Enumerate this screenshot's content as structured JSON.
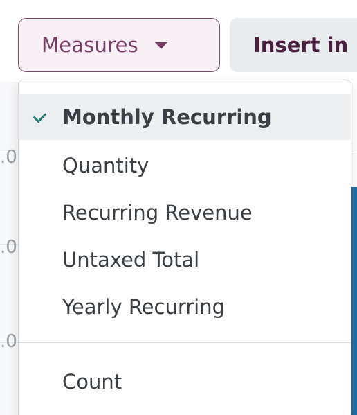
{
  "toolbar": {
    "measures_label": "Measures",
    "insert_label": "Insert in"
  },
  "chart": {
    "y_tick_fragments": [
      ".0",
      ".0",
      ".0"
    ],
    "bar_color": "#1f6fa8"
  },
  "measures_menu": {
    "items": [
      {
        "label": "Monthly Recurring",
        "selected": true
      },
      {
        "label": "Quantity",
        "selected": false
      },
      {
        "label": "Recurring Revenue",
        "selected": false
      },
      {
        "label": "Untaxed Total",
        "selected": false
      },
      {
        "label": "Yearly Recurring",
        "selected": false
      }
    ],
    "count_label": "Count"
  },
  "colors": {
    "accent": "#7a3c66",
    "check": "#1e7a74",
    "selected_bg": "#eceef0"
  },
  "icons": {
    "dropdown_caret": "caret-down-icon",
    "selected_mark": "check-icon"
  }
}
